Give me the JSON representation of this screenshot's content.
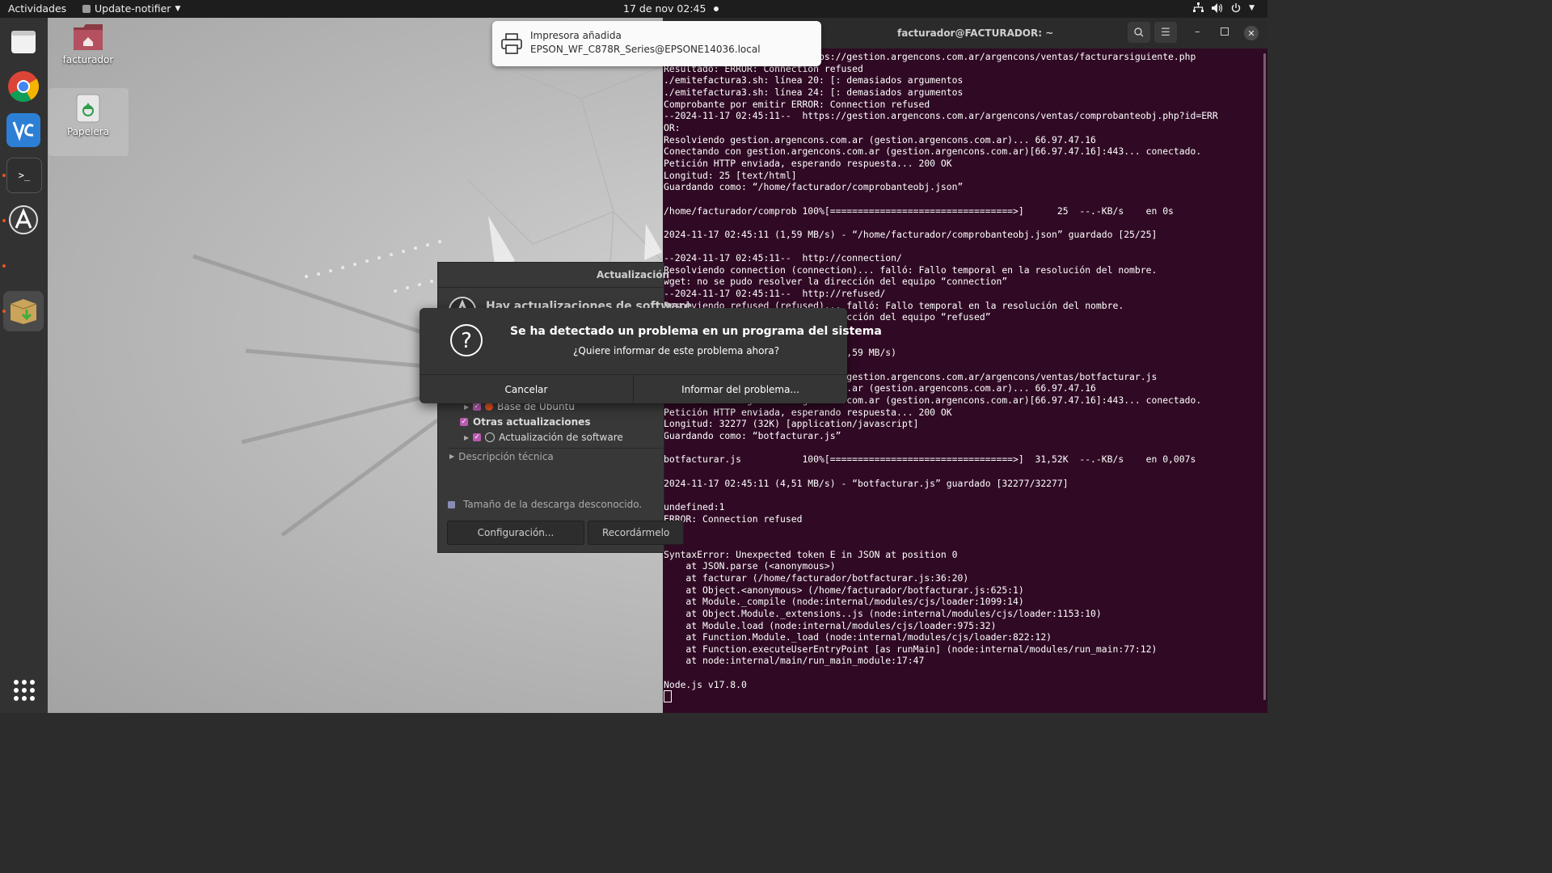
{
  "topbar": {
    "activities": "Actividades",
    "app_name": "Update-notifier",
    "clock": "17 de nov  02:45"
  },
  "desktop_icons": [
    {
      "label": "facturador"
    },
    {
      "label": "Papelera"
    }
  ],
  "notification": {
    "title": "Impresora añadida",
    "body": "EPSON_WF_C878R_Series@EPSONE14036.local"
  },
  "update_window": {
    "title": "Actualización",
    "heading": "Hay actualizaciones de software",
    "item_base": "Base de Ubuntu",
    "other_updates": "Otras actualizaciones",
    "item_software": "Actualización de software",
    "technical": "Descripción técnica",
    "download_size": "Tamaño de la descarga desconocido.",
    "settings_button": "Configuración...",
    "remind_button": "Recordármelo"
  },
  "alert_dialog": {
    "title": "Se ha detectado un problema en un programa del sistema",
    "subtitle": "¿Quiere informar de este problema ahora?",
    "cancel": "Cancelar",
    "report": "Informar del problema..."
  },
  "terminal": {
    "title": "facturador@FACTURADOR: ~",
    "lines": [
      "--2024-11-17 02:45:11--  https://gestion.argencons.com.ar/argencons/ventas/facturarsiguiente.php",
      "Resultado: ERROR: Connection refused",
      "./emitefactura3.sh: línea 20: [: demasiados argumentos",
      "./emitefactura3.sh: línea 24: [: demasiados argumentos",
      "Comprobante por emitir ERROR: Connection refused",
      "--2024-11-17 02:45:11--  https://gestion.argencons.com.ar/argencons/ventas/comprobanteobj.php?id=ERR",
      "OR:",
      "Resolviendo gestion.argencons.com.ar (gestion.argencons.com.ar)... 66.97.47.16",
      "Conectando con gestion.argencons.com.ar (gestion.argencons.com.ar)[66.97.47.16]:443... conectado.",
      "Petición HTTP enviada, esperando respuesta... 200 OK",
      "Longitud: 25 [text/html]",
      "Guardando como: “/home/facturador/comprobanteobj.json”",
      "",
      "/home/facturador/comprob 100%[=================================>]      25  --.-KB/s    en 0s",
      "",
      "2024-11-17 02:45:11 (1,59 MB/s) - “/home/facturador/comprobanteobj.json” guardado [25/25]",
      "",
      "--2024-11-17 02:45:11--  http://connection/",
      "Resolviendo connection (connection)... falló: Fallo temporal en la resolución del nombre.",
      "wget: no se pudo resolver la dirección del equipo “connection”",
      "--2024-11-17 02:45:11--  http://refused/",
      "Resolviendo refused (refused)... falló: Fallo temporal en la resolución del nombre.",
      "wget: no se pudo resolver la dirección del equipo “refused”",
      "",
      "",
      "                            0s (1,59 MB/s)",
      "",
      "--2024-11-17 02:45:11--  https://gestion.argencons.com.ar/argencons/ventas/botfacturar.js",
      "Resolviendo gestion.argencons.com.ar (gestion.argencons.com.ar)... 66.97.47.16",
      "Conectando con gestion.argencons.com.ar (gestion.argencons.com.ar)[66.97.47.16]:443... conectado.",
      "Petición HTTP enviada, esperando respuesta... 200 OK",
      "Longitud: 32277 (32K) [application/javascript]",
      "Guardando como: “botfacturar.js”",
      "",
      "botfacturar.js           100%[=================================>]  31,52K  --.-KB/s    en 0,007s",
      "",
      "2024-11-17 02:45:11 (4,51 MB/s) - “botfacturar.js” guardado [32277/32277]",
      "",
      "undefined:1",
      "ERROR: Connection refused",
      "^",
      "",
      "SyntaxError: Unexpected token E in JSON at position 0",
      "    at JSON.parse (<anonymous>)",
      "    at facturar (/home/facturador/botfacturar.js:36:20)",
      "    at Object.<anonymous> (/home/facturador/botfacturar.js:625:1)",
      "    at Module._compile (node:internal/modules/cjs/loader:1099:14)",
      "    at Object.Module._extensions..js (node:internal/modules/cjs/loader:1153:10)",
      "    at Module.load (node:internal/modules/cjs/loader:975:32)",
      "    at Function.Module._load (node:internal/modules/cjs/loader:822:12)",
      "    at Function.executeUserEntryPoint [as runMain] (node:internal/modules/run_main:77:12)",
      "    at node:internal/main/run_main_module:17:47",
      "",
      "Node.js v17.8.0"
    ]
  }
}
